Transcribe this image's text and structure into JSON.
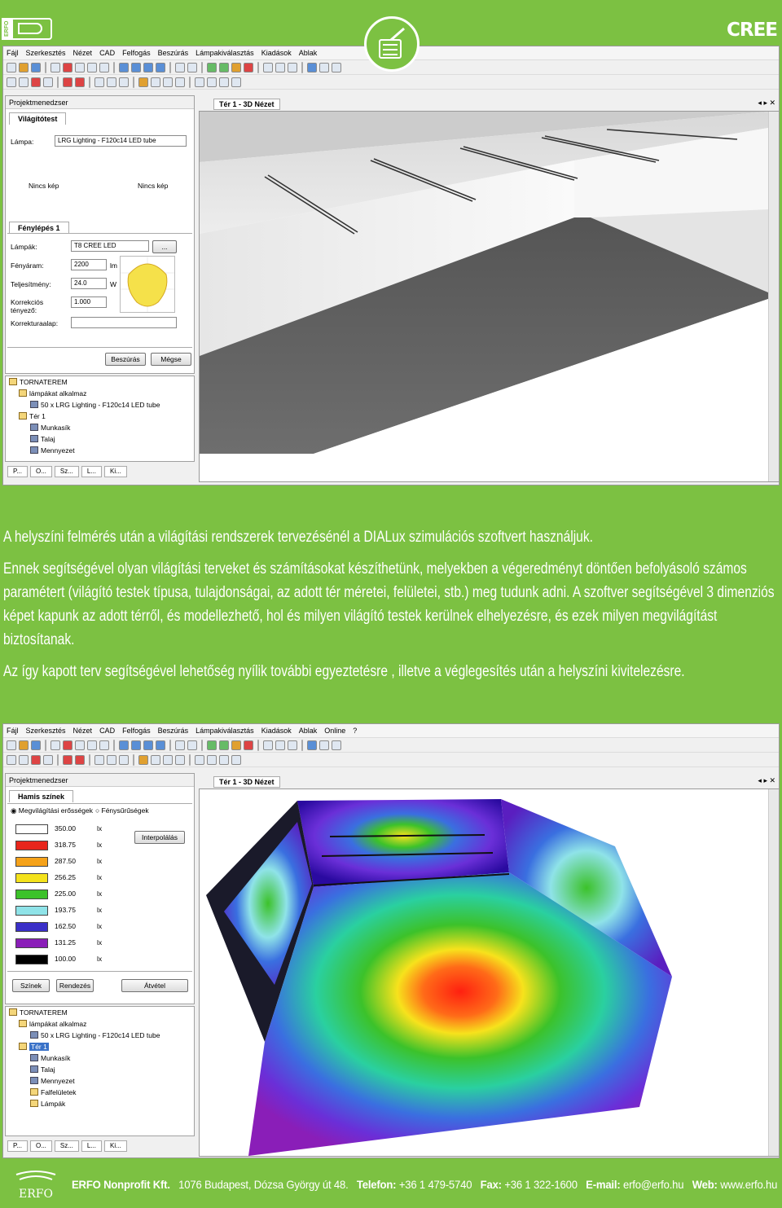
{
  "brand": {
    "left_logo": "ERFO",
    "right_logo": "CREE"
  },
  "menu": [
    "Fájl",
    "Szerkesztés",
    "Nézet",
    "CAD",
    "Felfogás",
    "Beszúrás",
    "Lámpakiválasztás",
    "Kiadások",
    "Ablak",
    "Online",
    "?"
  ],
  "win1": {
    "panel_title": "Projektmenedzser",
    "tab": "Világítótest",
    "lampa_label": "Lámpa:",
    "lampa_value": "LRG Lighting - F120c14 LED tube",
    "nincs1": "Nincs kép",
    "nincs2": "Nincs kép",
    "step_tab": "Fénylépés 1",
    "fields": [
      {
        "label": "Lámpák:",
        "value": "T8 CREE LED",
        "unit": ""
      },
      {
        "label": "Fényáram:",
        "value": "2200",
        "unit": "lm"
      },
      {
        "label": "Teljesítmény:",
        "value": "24.0",
        "unit": "W"
      },
      {
        "label": "Korrekciós tényező:",
        "value": "1.000",
        "unit": ""
      },
      {
        "label": "Korrekturaalap:",
        "value": "",
        "unit": ""
      }
    ],
    "btn_insert": "Beszúrás",
    "btn_cancel": "Mégse",
    "tree": [
      "TORNATEREM",
      "lámpákat alkalmaz",
      "50 x LRG Lighting - F120c14 LED tube",
      "Tér 1",
      "Munkasík",
      "Talaj",
      "Mennyezet"
    ],
    "bottom_tabs": [
      "P...",
      "O...",
      "Sz...",
      "L...",
      "Ki..."
    ],
    "view_tab": "Tér 1 - 3D Nézet"
  },
  "paragraphs": [
    "A helyszíni felmérés után a világítási rendszerek tervezésénél a DIALux szimulációs szoftvert használjuk.",
    "Ennek segítségével olyan világítási terveket és számításokat készíthetünk, melyekben a végeredményt döntően befolyásoló számos paramétert (világító testek típusa, tulajdonságai, az adott tér méretei, felületei, stb.) meg tudunk adni. A szoftver segítségével 3 dimenziós képet kapunk az adott térről, és modellezhető, hol és milyen világító testek kerülnek elhelyezésre, és ezek milyen megvilágítást biztosítanak.",
    "Az így kapott terv segítségével lehetőség nyílik további egyeztetésre , illetve a véglegesítés után a helyszíni kivitelezésre."
  ],
  "win2": {
    "panel_title": "Projektmenedzser",
    "tab": "Hamis színek",
    "radio1": "Megvilágítási erősségek",
    "radio2": "Fénysűrűségek",
    "legend": [
      {
        "color": "#ffffff",
        "value": "350.00",
        "unit": "lx"
      },
      {
        "color": "#e8261c",
        "value": "318.75",
        "unit": "lx"
      },
      {
        "color": "#f5a21a",
        "value": "287.50",
        "unit": "lx"
      },
      {
        "color": "#f4e21c",
        "value": "256.25",
        "unit": "lx"
      },
      {
        "color": "#3cc22a",
        "value": "225.00",
        "unit": "lx"
      },
      {
        "color": "#8fe3e8",
        "value": "193.75",
        "unit": "lx"
      },
      {
        "color": "#3a2fc8",
        "value": "162.50",
        "unit": "lx"
      },
      {
        "color": "#8a1eb8",
        "value": "131.25",
        "unit": "lx"
      },
      {
        "color": "#000000",
        "value": "100.00",
        "unit": "lx"
      }
    ],
    "btn_interp": "Interpolálás",
    "btn_colors": "Színek",
    "btn_order": "Rendezés",
    "btn_apply": "Átvétel",
    "tree": [
      "TORNATEREM",
      "lámpákat alkalmaz",
      "50 x LRG Lighting - F120c14 LED tube",
      "Tér 1",
      "Munkasík",
      "Talaj",
      "Mennyezet",
      "Falfelületek",
      "Lámpák"
    ],
    "bottom_tabs": [
      "P...",
      "O...",
      "Sz...",
      "L...",
      "Ki..."
    ],
    "view_tab": "Tér 1 - 3D Nézet"
  },
  "footer": {
    "company": "ERFO Nonprofit Kft.",
    "address": "1076 Budapest, Dózsa György út 48.",
    "phone_label": "Telefon:",
    "phone": "+36 1 479-5740",
    "fax_label": "Fax:",
    "fax": "+36 1 322-1600",
    "email_label": "E-mail:",
    "email": "erfo@erfo.hu",
    "web_label": "Web:",
    "web": "www.erfo.hu",
    "logo": "ERFO"
  }
}
